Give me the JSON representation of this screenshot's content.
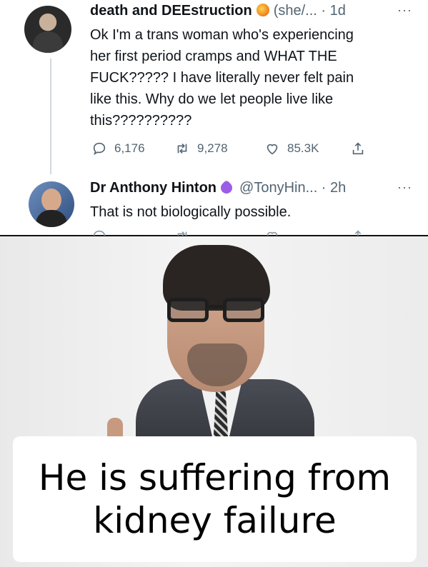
{
  "tweet1": {
    "display_name": "death and DEEstruction",
    "meta": "(she/... · 1d",
    "more": "···",
    "lines": [
      "Ok I'm a trans woman who's experiencing",
      "her first period cramps and WHAT THE",
      "FUCK????? I have literally never felt pain",
      "like this. Why do we let people live like",
      "this??????????"
    ],
    "actions": {
      "replies": "6,176",
      "retweets": "9,278",
      "likes": "85.3K"
    }
  },
  "tweet2": {
    "display_name": "Dr Anthony Hinton",
    "meta": "@TonyHin... · 2h",
    "more": "···",
    "text": "That is not biologically possible."
  },
  "caption": {
    "line1": "He is suffering from",
    "line2": "kidney failure"
  },
  "colors": {
    "text": "#0f1419",
    "muted": "#536471",
    "thread_line": "#cfd9de",
    "badge_purple": "#9b5de5",
    "badge_flame": "#f08a24"
  },
  "icons": [
    "reply-icon",
    "retweet-icon",
    "like-icon",
    "share-icon",
    "more-icon"
  ]
}
